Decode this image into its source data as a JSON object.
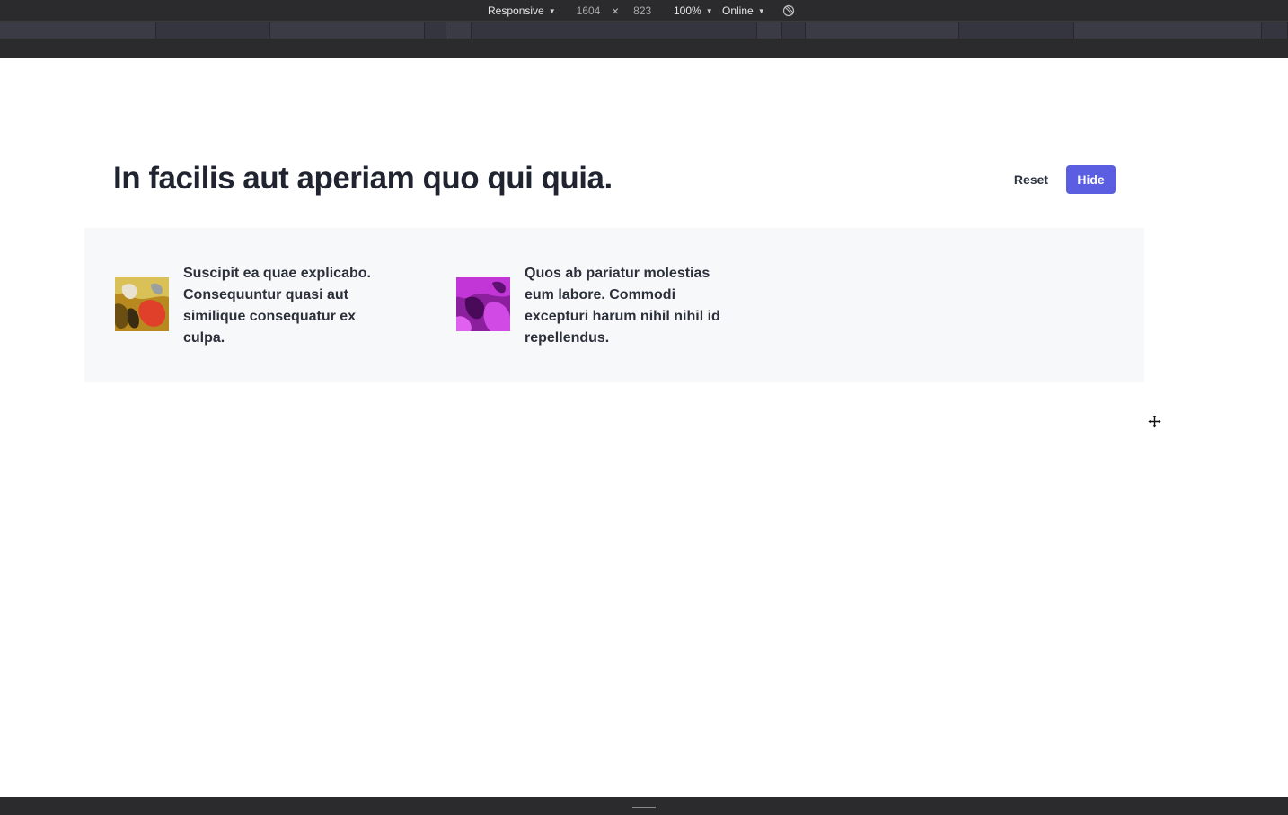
{
  "devtools": {
    "device_mode": "Responsive",
    "width": "1604",
    "height": "823",
    "dimension_separator": "×",
    "zoom": "100%",
    "throttling": "Online",
    "rotate_icon": "rotate-icon"
  },
  "page": {
    "title": "In facilis aut aperiam quo qui quia.",
    "reset_label": "Reset",
    "hide_label": "Hide",
    "accent_color": "#5b5ee0",
    "cards": [
      {
        "text": "Suscipit ea quae explicabo. Consequuntur quasi aut similique consequatur ex culpa.",
        "thumbnail": "abstract-yellow-red-image"
      },
      {
        "text": "Quos ab pariatur molestias eum labore. Commodi excepturi harum nihil nihil id repellendus.",
        "thumbnail": "abstract-magenta-image"
      }
    ]
  },
  "cursor": "move-cursor-icon"
}
